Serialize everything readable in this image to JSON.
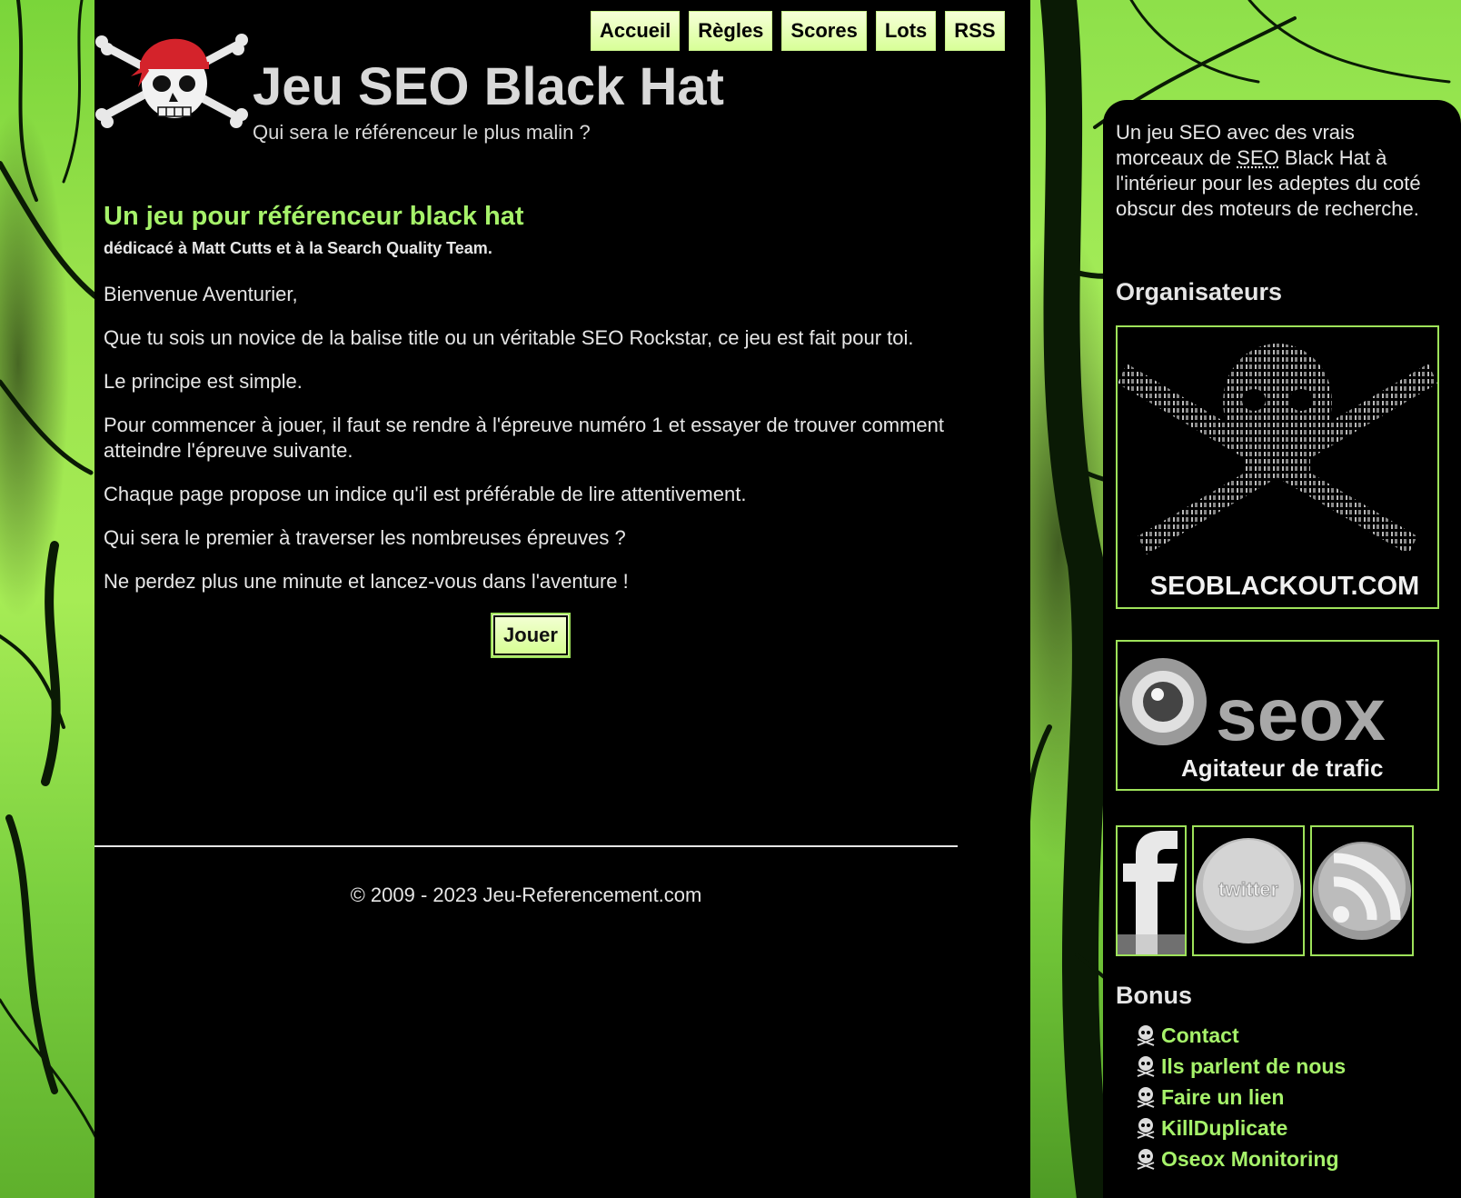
{
  "nav": {
    "items": [
      {
        "label": "Accueil"
      },
      {
        "label": "Règles"
      },
      {
        "label": "Scores"
      },
      {
        "label": "Lots"
      },
      {
        "label": "RSS"
      }
    ]
  },
  "header": {
    "title": "Jeu SEO Black Hat",
    "tagline": "Qui sera le référenceur le plus malin ?"
  },
  "main": {
    "heading": "Un jeu pour référenceur black hat",
    "dedication": "dédicacé à Matt Cutts et à la Search Quality Team.",
    "paragraphs": [
      "Bienvenue Aventurier,",
      "Que tu sois un novice de la balise title ou un véritable SEO Rockstar, ce jeu est fait pour toi.",
      "Le principe est simple.",
      "Pour commencer à jouer, il faut se rendre à l'épreuve numéro 1 et essayer de trouver comment atteindre l'épreuve suivante.",
      "Chaque page propose un indice qu'il est préférable de lire attentivement.",
      "Qui sera le premier à traverser les nombreuses épreuves ?",
      "Ne perdez plus une minute et lancez-vous dans l'aventure !"
    ],
    "play_button": "Jouer"
  },
  "footer": {
    "copyright": "© 2009 - 2023 Jeu-Referencement.com"
  },
  "sidebar": {
    "intro_before": "Un jeu SEO avec des vrais morceaux de ",
    "intro_abbr": "SEO",
    "intro_after": " Black Hat à l'intérieur pour les adeptes du coté obscur des moteurs de recherche.",
    "organizers_heading": "Organisateurs",
    "partners": [
      {
        "caption": "SEOBLACKOUT.COM"
      },
      {
        "word": "seox",
        "caption": "Agitateur de trafic"
      }
    ],
    "social": [
      {
        "icon": "facebook-icon"
      },
      {
        "icon": "twitter-icon",
        "text": "twitter"
      },
      {
        "icon": "rss-icon"
      }
    ],
    "bonus_heading": "Bonus",
    "bonus_links": [
      {
        "label": "Contact"
      },
      {
        "label": "Ils parlent de nous"
      },
      {
        "label": "Faire un lien"
      },
      {
        "label": "KillDuplicate"
      },
      {
        "label": "Oseox Monitoring"
      }
    ]
  },
  "colors": {
    "accent_green": "#a6f26a",
    "button_green": "#d8ff98",
    "background": "#000000",
    "text": "#e6e6e6"
  }
}
